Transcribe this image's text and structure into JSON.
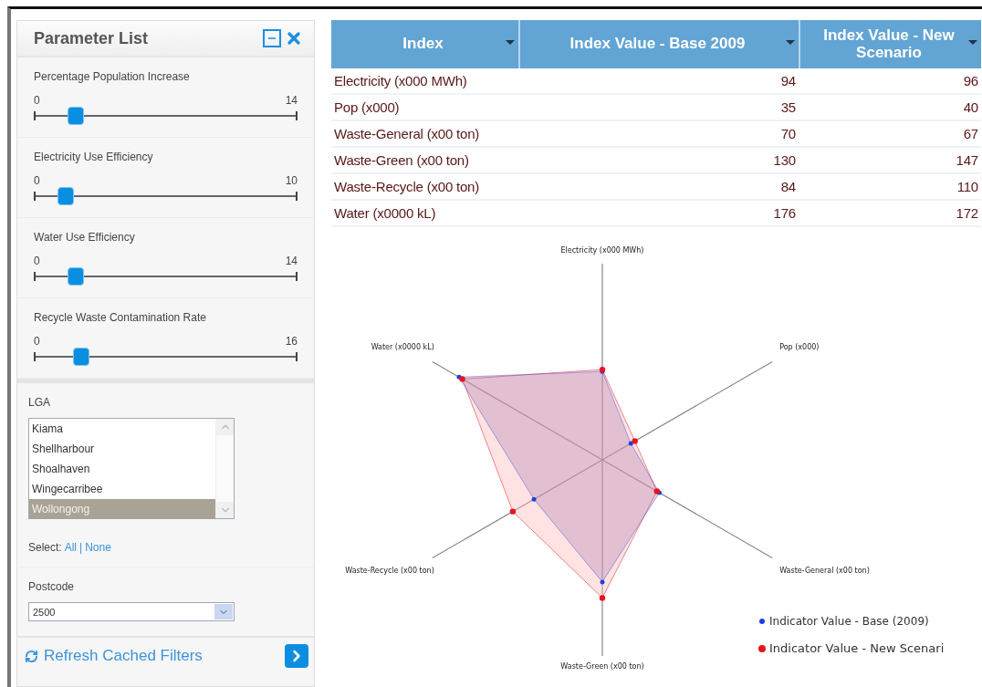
{
  "panel": {
    "title": "Parameter List",
    "sliders": [
      {
        "label": "Percentage Population Increase",
        "min": "0",
        "max": "14",
        "level": 0.16
      },
      {
        "label": "Electricity Use Efficiency",
        "min": "0",
        "max": "10",
        "level": 0.12
      },
      {
        "label": "Water Use Efficiency",
        "min": "0",
        "max": "14",
        "level": 0.16
      },
      {
        "label": "Recycle Waste Contamination Rate",
        "min": "0",
        "max": "16",
        "level": 0.18
      }
    ],
    "lga": {
      "label": "LGA",
      "items": [
        {
          "label": "Kiama",
          "selected": false
        },
        {
          "label": "Shellharbour",
          "selected": false
        },
        {
          "label": "Shoalhaven",
          "selected": false
        },
        {
          "label": "Wingecarribee",
          "selected": false
        },
        {
          "label": "Wollongong",
          "selected": true
        }
      ]
    },
    "select": {
      "label": "Select:",
      "all": "All",
      "separator": "|",
      "none": "None"
    },
    "postcode": {
      "label": "Postcode",
      "value": "2500"
    },
    "footer": {
      "label": "Refresh Cached Filters"
    }
  },
  "table": {
    "columns": [
      "Index",
      "Index Value - Base 2009",
      "Index Value - New Scenario"
    ],
    "rows": [
      [
        "Electricity (x000 MWh)",
        "94",
        "96"
      ],
      [
        "Pop (x000)",
        "35",
        "40"
      ],
      [
        "Waste-General (x00 ton)",
        "70",
        "67"
      ],
      [
        "Waste-Green (x00 ton)",
        "130",
        "147"
      ],
      [
        "Waste-Recycle (x00 ton)",
        "84",
        "110"
      ],
      [
        "Water (x0000 kL)",
        "176",
        "172"
      ]
    ]
  },
  "chart": {
    "axis_label_rows": [
      [
        "Electricity (x000 MWh)"
      ],
      [
        "Water (x0000 kL)",
        "Pop (x000)"
      ],
      [
        "Waste-Recycle (x00 ton)",
        "Waste-General (x00 ton)"
      ],
      [
        "Waste-Green (x00 ton)"
      ]
    ],
    "legend": [
      {
        "label": "Indicator Value - Base (2009)",
        "color": "#1f3fe0"
      },
      {
        "label": "Indicator Value - New Scenari",
        "color": "#e8141c"
      }
    ]
  }
}
